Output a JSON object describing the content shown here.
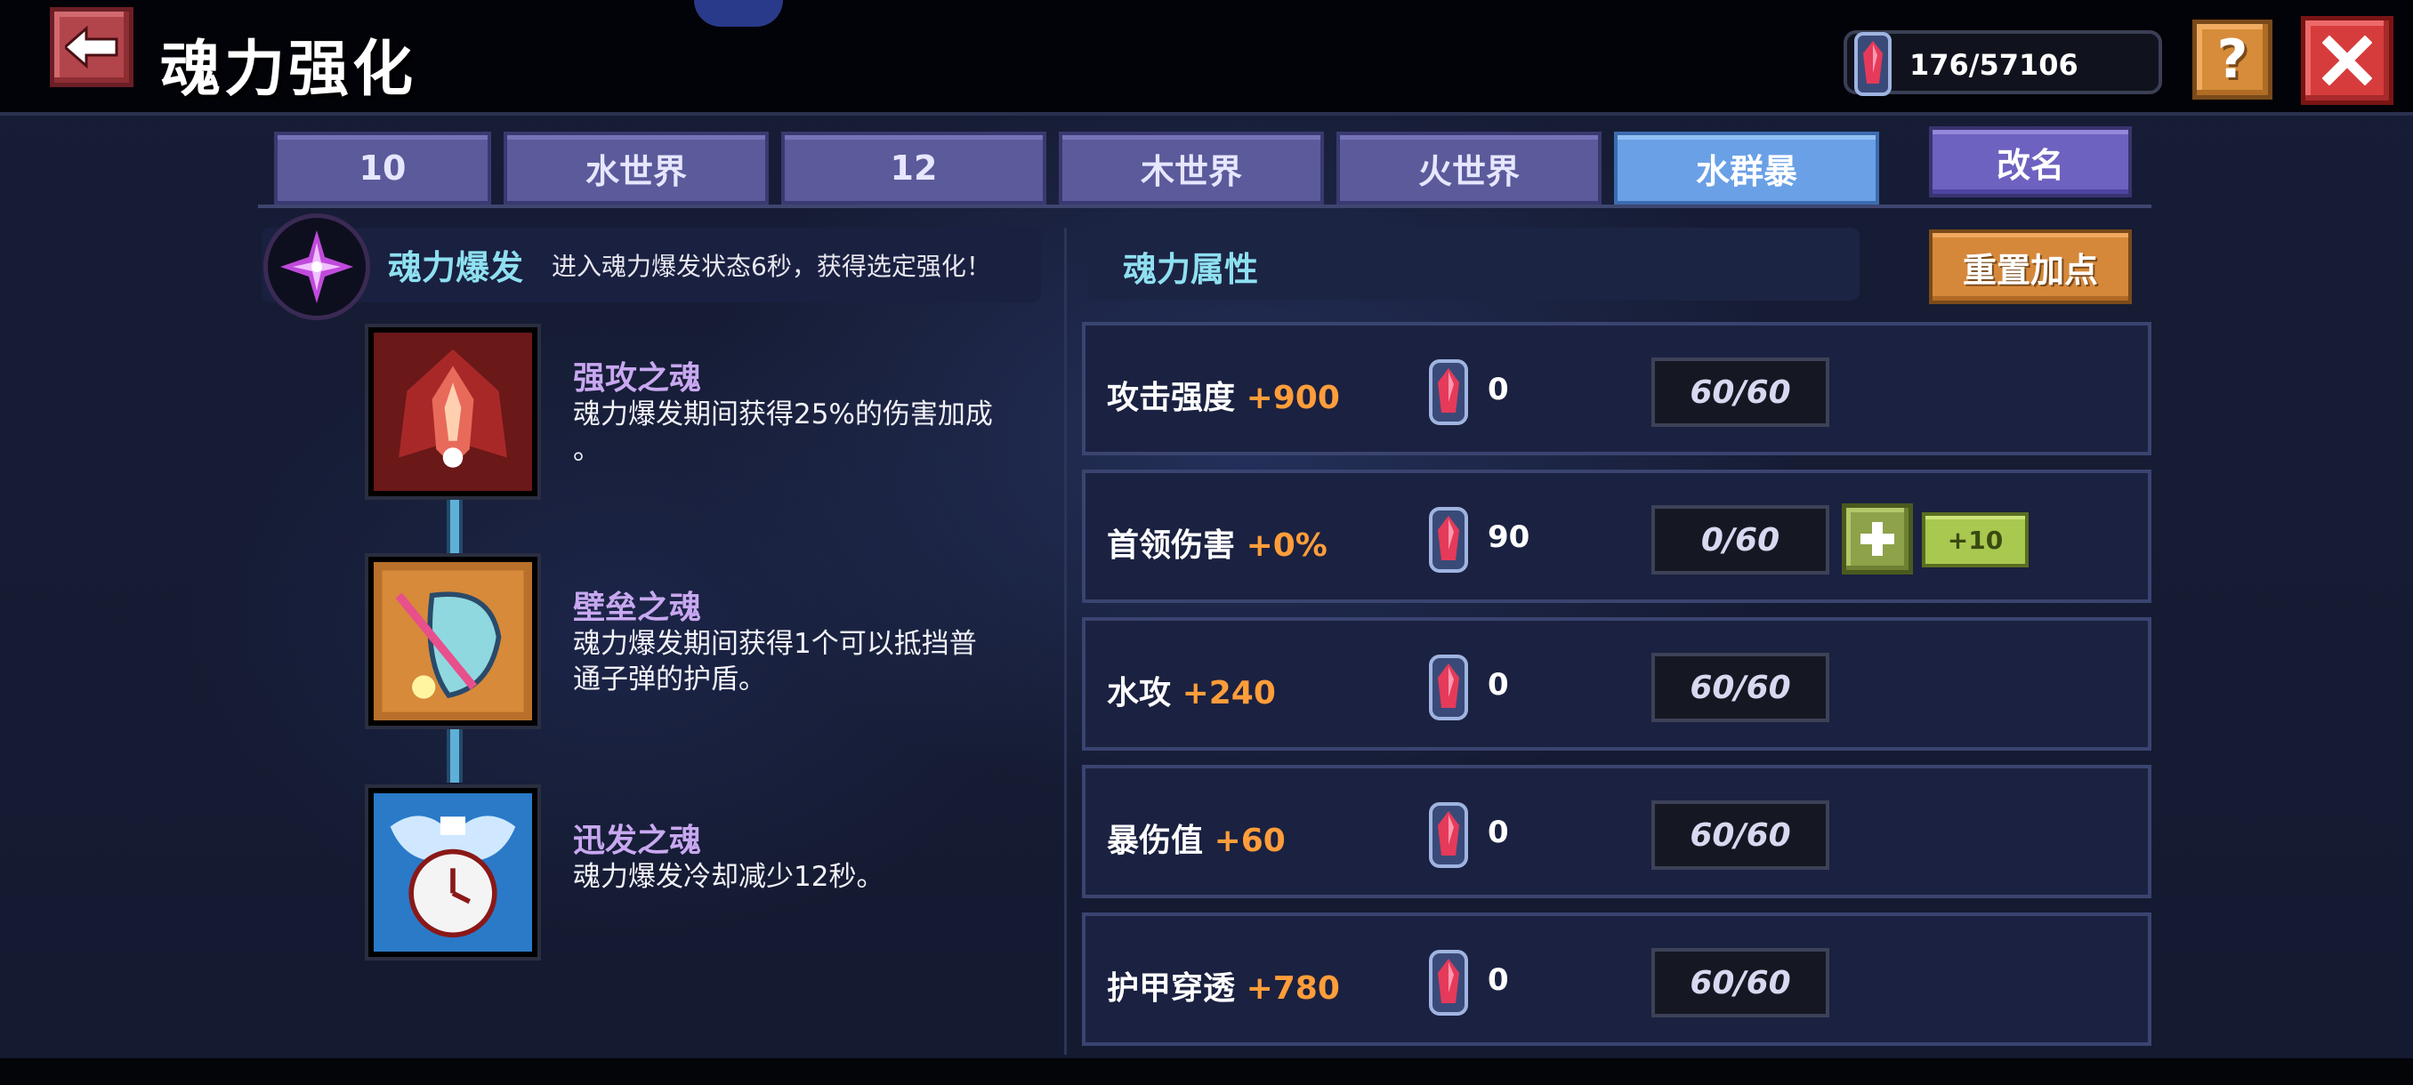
{
  "header": {
    "title": "魂力强化",
    "currency_value": "176/57106",
    "help_label": "?"
  },
  "tabs": [
    {
      "label": "10",
      "active": false
    },
    {
      "label": "水世界",
      "active": false
    },
    {
      "label": "12",
      "active": false
    },
    {
      "label": "木世界",
      "active": false
    },
    {
      "label": "火世界",
      "active": false
    },
    {
      "label": "水群暴",
      "active": true
    }
  ],
  "rename_label": "改名",
  "burst": {
    "title": "魂力爆发",
    "description": "进入魂力爆发状态6秒，获得选定强化！"
  },
  "skills": [
    {
      "name": "强攻之魂",
      "line1": "魂力爆发期间获得25%的伤害加成",
      "line2": "。",
      "icon": "red-spirit-icon"
    },
    {
      "name": "壁垒之魂",
      "line1": "魂力爆发期间获得1个可以抵挡普",
      "line2": "通子弹的护盾。",
      "icon": "shield-spirit-icon"
    },
    {
      "name": "迅发之魂",
      "line1": "魂力爆发冷却减少12秒。",
      "line2": "",
      "icon": "clock-spirit-icon"
    }
  ],
  "attributes_panel": {
    "title": "魂力属性",
    "reset_label": "重置加点"
  },
  "attributes": [
    {
      "name": "攻击强度",
      "bonus": "+900",
      "cost": "0",
      "level": "60/60",
      "upgradable": false
    },
    {
      "name": "首领伤害",
      "bonus": "+0%",
      "cost": "90",
      "level": "0/60",
      "upgradable": true,
      "plus10_label": "+10"
    },
    {
      "name": "水攻",
      "bonus": "+240",
      "cost": "0",
      "level": "60/60",
      "upgradable": false
    },
    {
      "name": "暴伤值",
      "bonus": "+60",
      "cost": "0",
      "level": "60/60",
      "upgradable": false
    },
    {
      "name": "护甲穿透",
      "bonus": "+780",
      "cost": "0",
      "level": "60/60",
      "upgradable": false
    }
  ],
  "colors": {
    "accent_cyan": "#8ee0f0",
    "bonus_orange": "#ff9d3a",
    "active_tab": "#6aa0e6",
    "tab": "#5b5a9a"
  }
}
